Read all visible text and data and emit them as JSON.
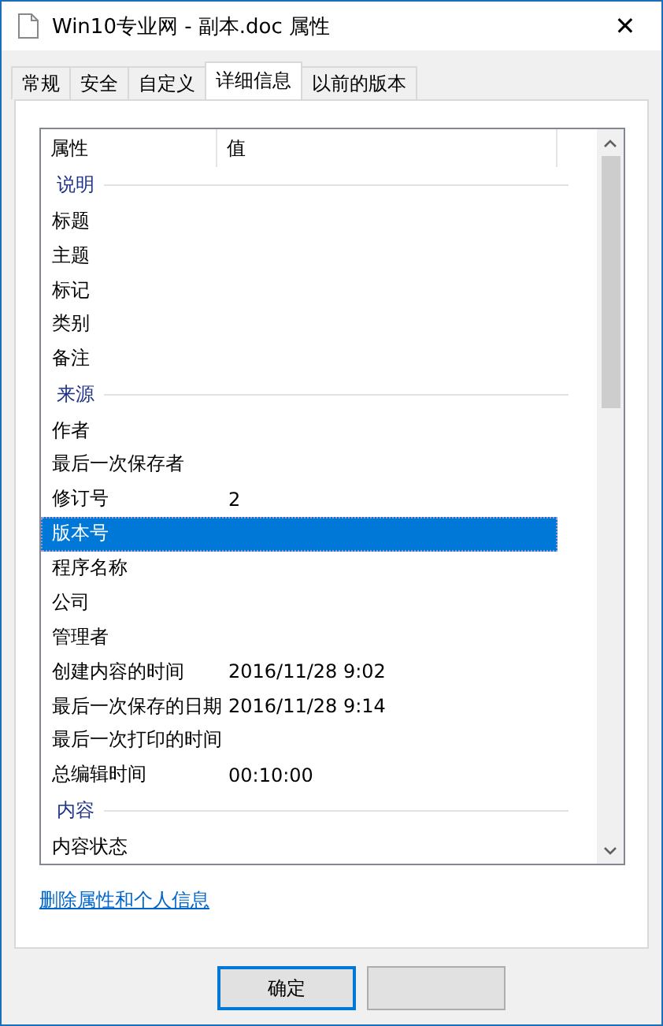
{
  "window": {
    "title": "Win10专业网 - 副本.doc 属性",
    "close": "✕"
  },
  "tabs": [
    {
      "label": "常规",
      "selected": false
    },
    {
      "label": "安全",
      "selected": false
    },
    {
      "label": "自定义",
      "selected": false
    },
    {
      "label": "详细信息",
      "selected": true
    },
    {
      "label": "以前的版本",
      "selected": false
    }
  ],
  "table": {
    "columns": [
      "属性",
      "值"
    ],
    "rows": [
      {
        "kind": "group",
        "name": "说明"
      },
      {
        "kind": "property",
        "name": "标题",
        "selected": false
      },
      {
        "kind": "property",
        "name": "主题",
        "selected": false
      },
      {
        "kind": "property",
        "name": "标记",
        "selected": false
      },
      {
        "kind": "property",
        "name": "类别",
        "selected": false
      },
      {
        "kind": "property",
        "name": "备注",
        "selected": false
      },
      {
        "kind": "group",
        "name": "来源"
      },
      {
        "kind": "property",
        "name": "作者",
        "selected": false
      },
      {
        "kind": "property",
        "name": "最后一次保存者",
        "selected": false
      },
      {
        "kind": "property",
        "name": "修订号",
        "value": "2",
        "selected": false
      },
      {
        "kind": "property",
        "name": "版本号",
        "selected": true
      },
      {
        "kind": "property",
        "name": "程序名称",
        "selected": false
      },
      {
        "kind": "property",
        "name": "公司",
        "selected": false
      },
      {
        "kind": "property",
        "name": "管理者",
        "selected": false
      },
      {
        "kind": "property",
        "name": "创建内容的时间",
        "value": "2016/11/28 9:02",
        "selected": false
      },
      {
        "kind": "property",
        "name": "最后一次保存的日期",
        "value": "2016/11/28 9:14",
        "selected": false
      },
      {
        "kind": "property",
        "name": "最后一次打印的时间",
        "selected": false
      },
      {
        "kind": "property",
        "name": "总编辑时间",
        "value": "00:10:00",
        "selected": false
      },
      {
        "kind": "group",
        "name": "内容"
      },
      {
        "kind": "property",
        "name": "内容状态",
        "selected": false
      }
    ]
  },
  "link": "删除属性和个人信息",
  "buttons": [
    {
      "kind": "default",
      "label": "确定"
    },
    {
      "kind": "plain"
    }
  ]
}
